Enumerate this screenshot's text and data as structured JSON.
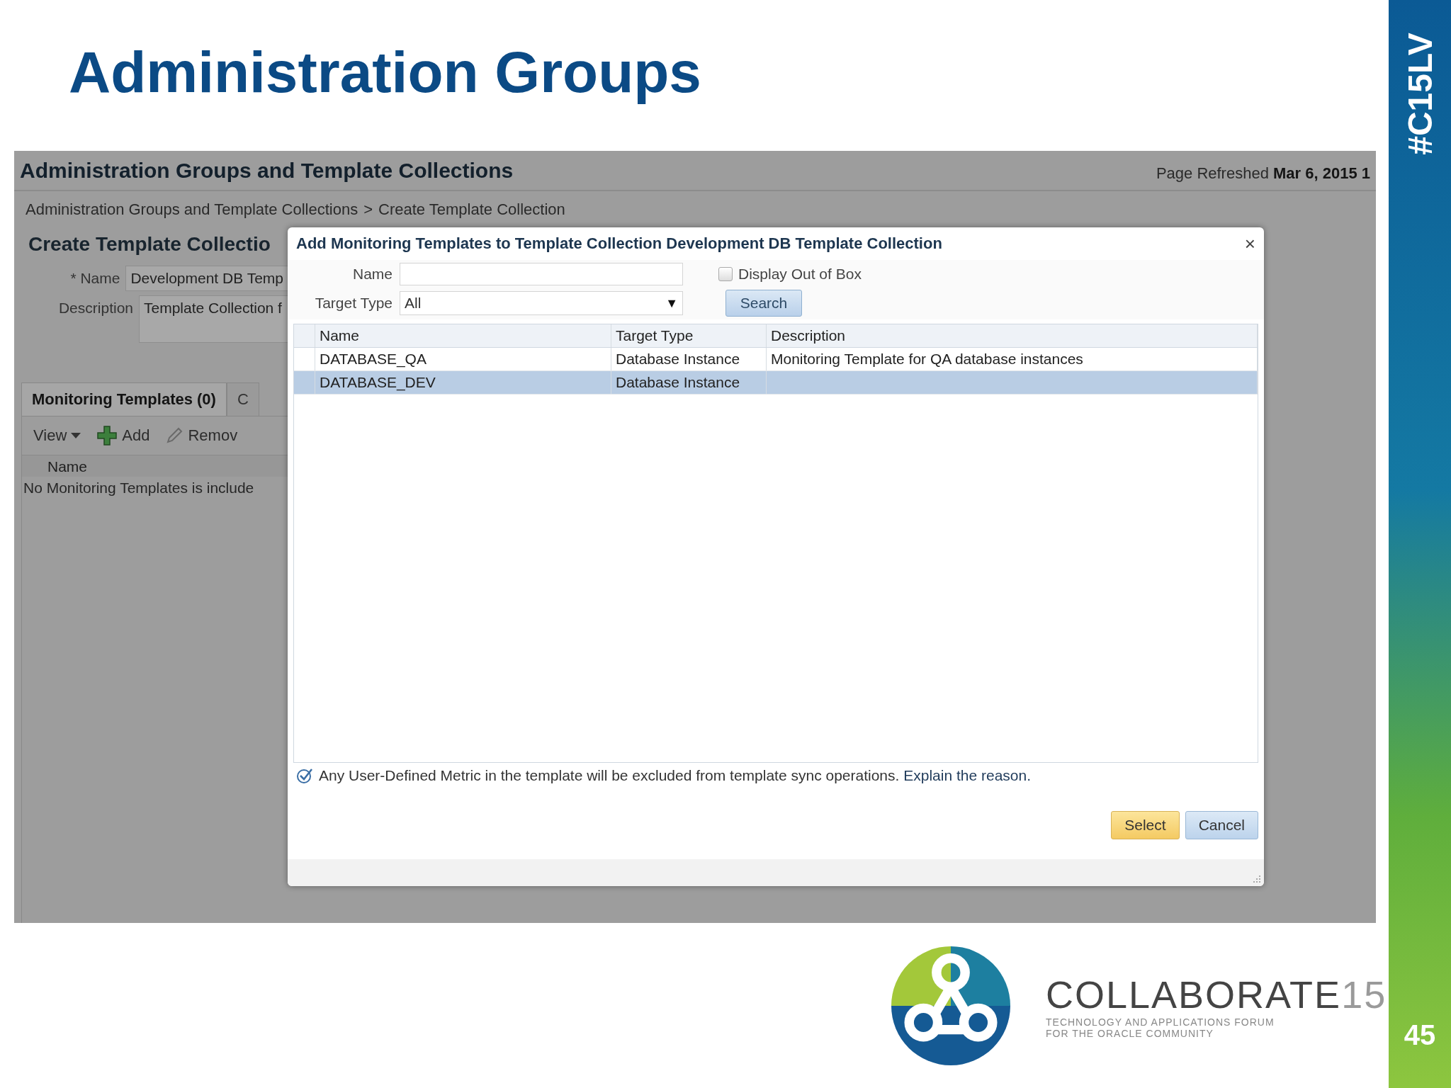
{
  "slide": {
    "title": "Administration Groups",
    "hashtag": "#C15LV",
    "page_number": "45",
    "logo": {
      "name": "COLLABORATE",
      "edition": "15",
      "tagline": [
        "TECHNOLOGY AND APPLICATIONS FORUM",
        "FOR THE ORACLE COMMUNITY"
      ]
    }
  },
  "background_page": {
    "header": "Administration Groups and Template Collections",
    "refreshed_label": "Page Refreshed",
    "refreshed_value": "Mar 6, 2015 1",
    "breadcrumb": [
      "Administration Groups and Template Collections",
      "Create Template Collection"
    ],
    "breadcrumb_separator": ">",
    "section_title": "Create Template Collectio",
    "fields": [
      {
        "label": "* Name",
        "value": "Development DB Temp",
        "kind": "line"
      },
      {
        "label": "Description",
        "value": "Template Collection f",
        "kind": "area"
      }
    ],
    "tabs": [
      {
        "label": "Monitoring Templates (0)",
        "selected": true
      },
      {
        "label": "C",
        "selected": false
      }
    ],
    "toolbar": [
      {
        "kind": "menu",
        "label": "View"
      },
      {
        "kind": "add",
        "label": "Add"
      },
      {
        "kind": "remove",
        "label": "Remov"
      }
    ],
    "table": {
      "columns": [
        "Name"
      ],
      "empty_text": "No Monitoring Templates is include"
    }
  },
  "dialog": {
    "title": "Add Monitoring Templates to Template Collection Development DB Template Collection",
    "close": "×",
    "name_filter": {
      "label": "Name"
    },
    "checkbox": {
      "label": "Display Out of Box",
      "checked": false
    },
    "target_type": {
      "label": "Target Type",
      "value": "All",
      "arrow": "▼"
    },
    "search_button": "Search",
    "table": {
      "columns": [
        "Name",
        "Target Type",
        "Description"
      ],
      "rows": [
        {
          "name": "DATABASE_QA",
          "target_type": "Database Instance",
          "description": "Monitoring Template for QA database instances",
          "selected": false
        },
        {
          "name": "DATABASE_DEV",
          "target_type": "Database Instance",
          "selected": true
        }
      ]
    },
    "notice": {
      "text": "Any User-Defined Metric in the template will be excluded from template sync operations.",
      "link": "Explain the reason."
    },
    "buttons": [
      {
        "label": "Select",
        "kind": "primary"
      },
      {
        "label": "Cancel",
        "kind": "secondary"
      }
    ]
  }
}
